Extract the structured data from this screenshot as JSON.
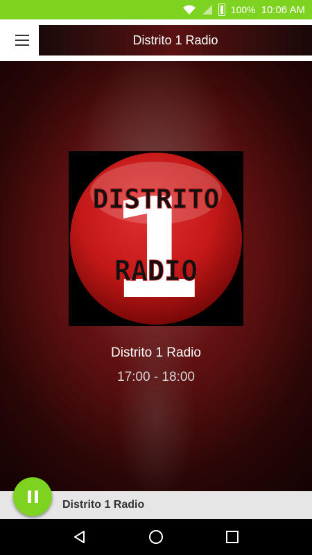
{
  "status_bar": {
    "battery": "100%",
    "time": "10:06 AM"
  },
  "header": {
    "title": "Distrito 1 Radio"
  },
  "now_playing": {
    "station_name": "Distrito 1 Radio",
    "schedule": "17:00 - 18:00",
    "cover_text": {
      "top": "DISTRITO",
      "number": "1",
      "bottom": "RADIO"
    }
  },
  "player": {
    "title": "Distrito 1 Radio",
    "state": "playing"
  },
  "colors": {
    "accent": "#7ed321",
    "logo_red": "#c41818"
  }
}
